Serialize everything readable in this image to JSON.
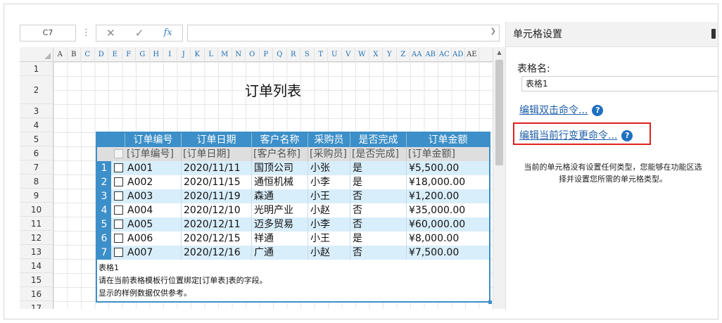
{
  "formula_bar": {
    "name_box": "C7",
    "cancel_icon": "close-icon",
    "confirm_icon": "check-icon",
    "fx_label": "fx",
    "value": ""
  },
  "sheet": {
    "columns": [
      "A",
      "B",
      "C",
      "D",
      "E",
      "F",
      "G",
      "H",
      "I",
      "J",
      "K",
      "L",
      "M",
      "N",
      "O",
      "P",
      "Q",
      "R",
      "S",
      "T",
      "U",
      "V",
      "W",
      "X",
      "Y",
      "Z",
      "AA",
      "AB",
      "AC",
      "AD",
      "AE"
    ],
    "rows": [
      "1",
      "2",
      "3",
      "4",
      "5",
      "6",
      "7",
      "8",
      "9",
      "10",
      "11",
      "12",
      "13",
      "14",
      "15",
      "16",
      "17"
    ],
    "title": "订单列表"
  },
  "table": {
    "headers": [
      "订单编号",
      "订单日期",
      "客户名称",
      "采购员",
      "是否完成",
      "订单金额"
    ],
    "bindings": [
      "[订单编号]",
      "[订单日期]",
      "[客户名称]",
      "[采购员]",
      "[是否完成]",
      "[订单金额]"
    ],
    "rows": [
      {
        "num": "1",
        "id": "A001",
        "date": "2020/11/11",
        "customer": "国顶公司",
        "buyer": "小张",
        "done": "是",
        "amount": "¥5,500.00"
      },
      {
        "num": "2",
        "id": "A002",
        "date": "2020/11/15",
        "customer": "通恒机械",
        "buyer": "小李",
        "done": "是",
        "amount": "¥18,000.00"
      },
      {
        "num": "3",
        "id": "A003",
        "date": "2020/11/19",
        "customer": "森通",
        "buyer": "小王",
        "done": "否",
        "amount": "¥1,200.00"
      },
      {
        "num": "4",
        "id": "A004",
        "date": "2020/12/10",
        "customer": "光明产业",
        "buyer": "小赵",
        "done": "否",
        "amount": "¥35,000.00"
      },
      {
        "num": "5",
        "id": "A005",
        "date": "2020/12/11",
        "customer": "迈多贸易",
        "buyer": "小李",
        "done": "否",
        "amount": "¥60,000.00"
      },
      {
        "num": "6",
        "id": "A006",
        "date": "2020/12/15",
        "customer": "祥通",
        "buyer": "小王",
        "done": "是",
        "amount": "¥8,000.00"
      },
      {
        "num": "7",
        "id": "A007",
        "date": "2020/12/16",
        "customer": "广通",
        "buyer": "小赵",
        "done": "否",
        "amount": "¥7,500.00"
      }
    ],
    "note_line1": "表格1",
    "note_line2": "请在当前表格模板行位置绑定[订单表]表的字段。",
    "note_line3": "显示的样例数据仅供参考。"
  },
  "panel": {
    "title": "单元格设置",
    "table_name_label": "表格名:",
    "table_name_value": "表格1",
    "link_double_click": "编辑双击命令...",
    "link_row_change": "编辑当前行变更命令...",
    "help_glyph": "?",
    "message": "当前的单元格没有设置任何类型，您能够在功能区选择并设置您所需的单元格类型。"
  },
  "colors": {
    "table_accent": "#3c8fc8",
    "row_alt": "#d9eefb",
    "highlight_box": "#e02020",
    "link": "#1f5ea8"
  }
}
